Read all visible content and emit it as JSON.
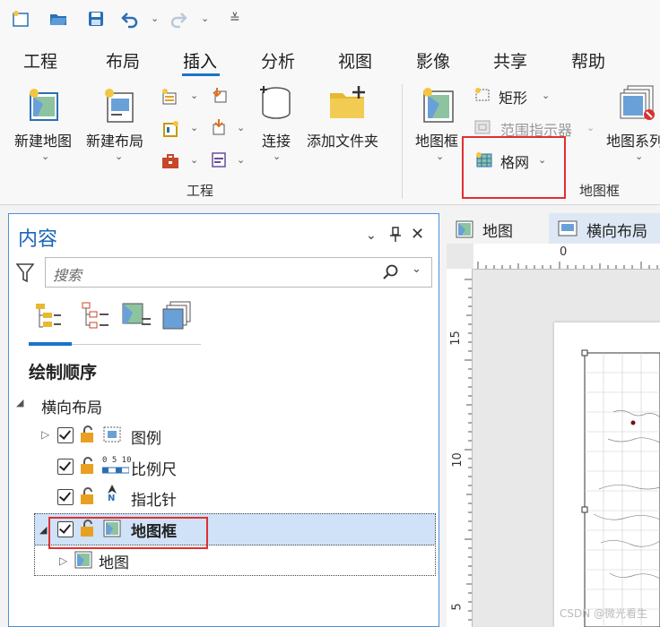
{
  "ribbon_tabs": [
    "工程",
    "布局",
    "插入",
    "分析",
    "视图",
    "影像",
    "共享",
    "帮助"
  ],
  "active_tab": "插入",
  "ribbon": {
    "new_map": "新建地图",
    "new_layout": "新建布局",
    "connect": "连接",
    "add_folder": "添加文件夹",
    "map_frame": "地图框",
    "rectangle": "矩形",
    "extent_indicator": "范围指示器",
    "grid": "格网",
    "map_system": "地图系列",
    "group_project": "工程",
    "group_map_frame": "地图框"
  },
  "contents": {
    "title": "内容",
    "search_placeholder": "搜索",
    "drawing_order": "绘制顺序",
    "root": "横向布局",
    "items": [
      {
        "label": "图例",
        "checked": true
      },
      {
        "label": "比例尺",
        "checked": true,
        "scale_text": "0 5 10"
      },
      {
        "label": "指北针",
        "checked": true,
        "north_letter": "N"
      },
      {
        "label": "地图框",
        "checked": true,
        "selected": true
      }
    ],
    "child": "地图"
  },
  "doc_tabs": [
    "地图",
    "横向布局"
  ],
  "ruler": {
    "top_zero": "0",
    "left_ticks": [
      "15",
      "10",
      "5"
    ]
  },
  "watermark": "CSDN @微光看生",
  "colors": {
    "accent": "#1a73c9",
    "highlight": "#cfe2f7",
    "red_box": "#e03030"
  }
}
